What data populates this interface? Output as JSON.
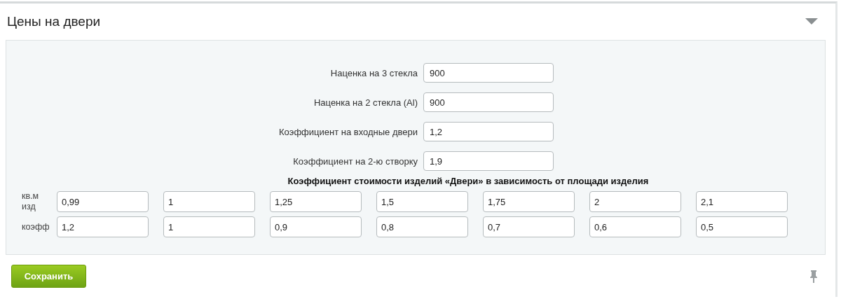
{
  "panel": {
    "title": "Цены на двери"
  },
  "fields": [
    {
      "label": "Наценка на 3 стекла",
      "value": "900"
    },
    {
      "label": "Наценка на 2 стекла (Al)",
      "value": "900"
    },
    {
      "label": "Коэффициент на входные двери",
      "value": "1,2"
    },
    {
      "label": "Коэффициент на 2-ю створку",
      "value": "1,9"
    }
  ],
  "table": {
    "title": "Коэффициент стоимости изделий «Двери» в зависимость от площади изделия",
    "rows": [
      {
        "label": "кв.м изд",
        "values": [
          "0,99",
          "1",
          "1,25",
          "1,5",
          "1,75",
          "2",
          "2,1"
        ]
      },
      {
        "label": "коэфф",
        "values": [
          "1,2",
          "1",
          "0,9",
          "0,8",
          "0,7",
          "0,6",
          "0,5"
        ]
      }
    ]
  },
  "save_button": "Сохранить"
}
